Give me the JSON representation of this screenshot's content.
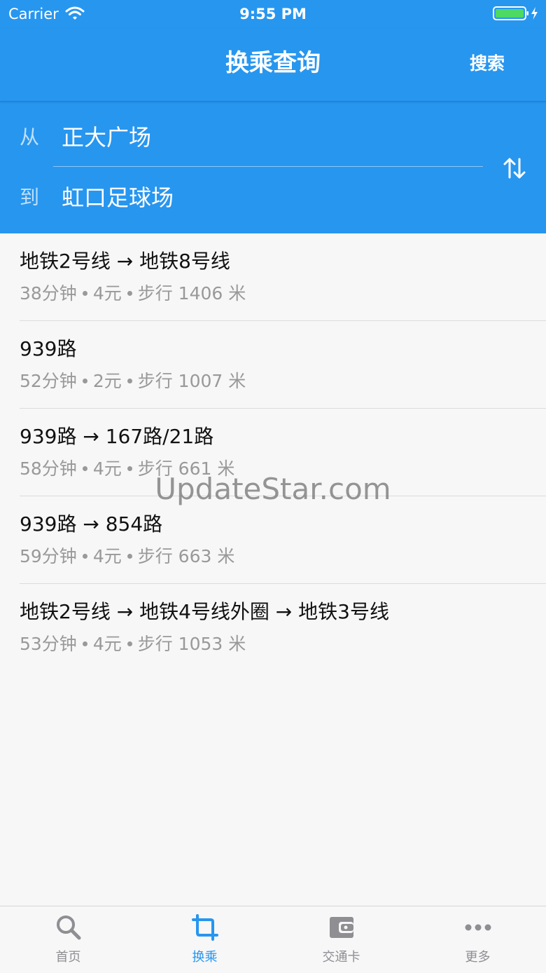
{
  "status_bar": {
    "carrier": "Carrier",
    "time": "9:55 PM"
  },
  "nav": {
    "title": "换乘查询",
    "search_label": "搜索"
  },
  "route": {
    "from_label": "从",
    "from_value": "正大广场",
    "to_label": "到",
    "to_value": "虹口足球场"
  },
  "results": [
    {
      "title": "地铁2号线 → 地铁8号线",
      "duration": "38分钟",
      "price": "4元",
      "walk": "步行 1406 米"
    },
    {
      "title": "939路",
      "duration": "52分钟",
      "price": "2元",
      "walk": "步行 1007 米"
    },
    {
      "title": "939路 → 167路/21路",
      "duration": "58分钟",
      "price": "4元",
      "walk": "步行 661 米"
    },
    {
      "title": "939路 → 854路",
      "duration": "59分钟",
      "price": "4元",
      "walk": "步行 663 米"
    },
    {
      "title": "地铁2号线 → 地铁4号线外圈 → 地铁3号线",
      "duration": "53分钟",
      "price": "4元",
      "walk": "步行 1053 米"
    }
  ],
  "watermark": "UpdateStar.com",
  "tabs": [
    {
      "label": "首页",
      "icon": "search-icon",
      "active": false
    },
    {
      "label": "换乘",
      "icon": "crop-icon",
      "active": true
    },
    {
      "label": "交通卡",
      "icon": "wallet-icon",
      "active": false
    },
    {
      "label": "更多",
      "icon": "more-icon",
      "active": false
    }
  ],
  "colors": {
    "primary": "#2796ef",
    "muted_text": "#999999",
    "tab_inactive": "#8e8e93"
  }
}
